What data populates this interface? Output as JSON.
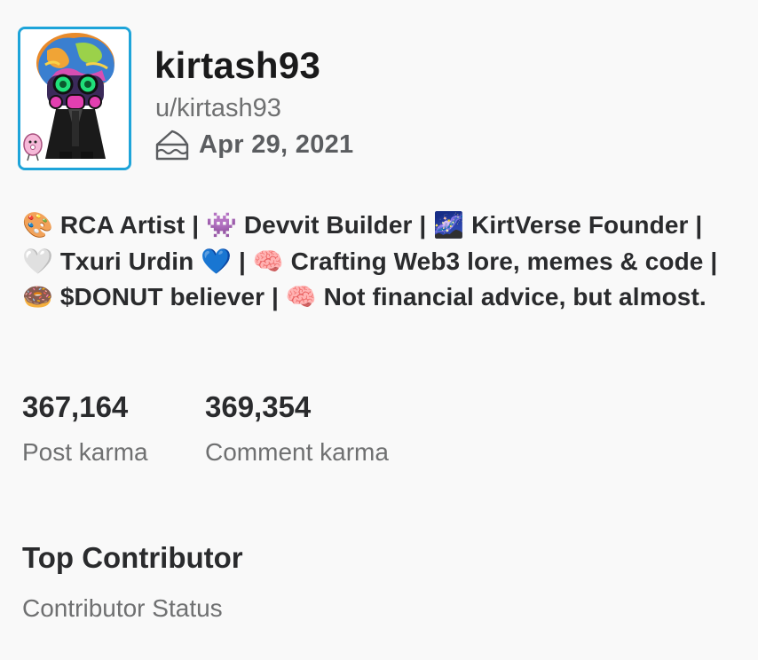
{
  "profile": {
    "display_name": "kirtash93",
    "handle": "u/kirtash93",
    "cake_day": "Apr 29, 2021",
    "avatar_border_color": "#1ea4d9",
    "cake_icon": "cake-icon"
  },
  "bio": {
    "text": "🎨 RCA Artist | 👾 Devvit Builder | 🌌 KirtVerse Founder | 🤍 Txuri Urdin 💙 | 🧠 Crafting Web3 lore, memes & code | 🍩 $DONUT believer | 🧠 Not financial advice, but almost."
  },
  "stats": {
    "post_karma": {
      "value": "367,164",
      "label": "Post karma"
    },
    "comment_karma": {
      "value": "369,354",
      "label": "Comment karma"
    }
  },
  "achievement": {
    "title": "Top Contributor",
    "subtitle": "Contributor Status"
  }
}
